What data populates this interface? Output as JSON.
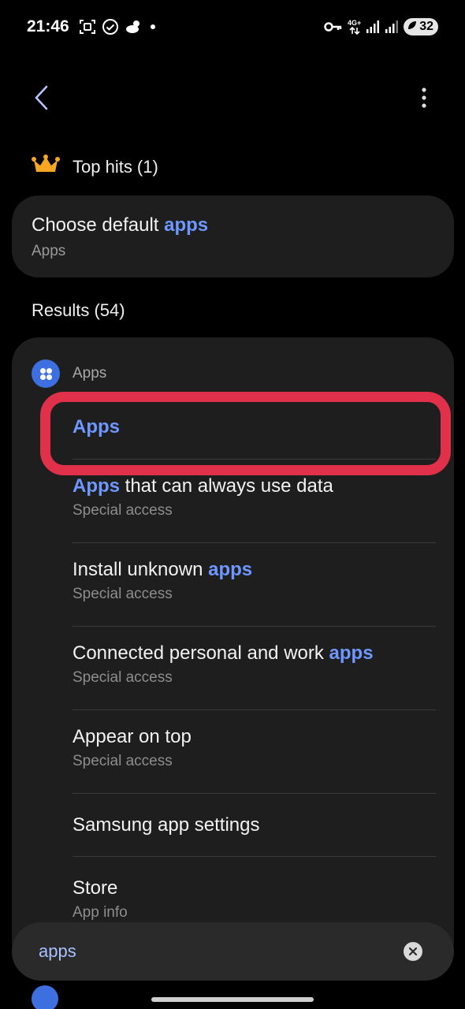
{
  "status_bar": {
    "time": "21:46",
    "network_label_top": "4G+",
    "battery": "32",
    "icons": [
      "screenshot-icon",
      "check-circle-icon",
      "weather-icon",
      "dot-icon",
      "vpn-key-icon",
      "data-arrows-icon",
      "signal-icon",
      "signal-icon",
      "battery-saver-icon"
    ]
  },
  "top_hits": {
    "header": "Top hits (1)",
    "item": {
      "title_prefix": "Choose default ",
      "title_highlight": "apps",
      "subtitle": "Apps"
    }
  },
  "results": {
    "header": "Results (54)",
    "group_label": "Apps",
    "items": [
      {
        "highlight": "Apps",
        "rest": "",
        "subtitle": ""
      },
      {
        "highlight": "Apps",
        "rest": " that can always use data",
        "subtitle": "Special access"
      },
      {
        "prefix": "Install unknown ",
        "highlight": "apps",
        "subtitle": "Special access"
      },
      {
        "prefix": "Connected personal and work ",
        "highlight": "apps",
        "subtitle": "Special access"
      },
      {
        "title": "Appear on top",
        "subtitle": "Special access"
      },
      {
        "title": "Samsung app settings",
        "subtitle": ""
      },
      {
        "title": "Store",
        "subtitle": "App info"
      }
    ]
  },
  "search": {
    "value": "apps"
  },
  "colors": {
    "highlight_text": "#6e97ff",
    "annotation_box": "#e0304a",
    "card_bg": "#1e1e1e"
  }
}
